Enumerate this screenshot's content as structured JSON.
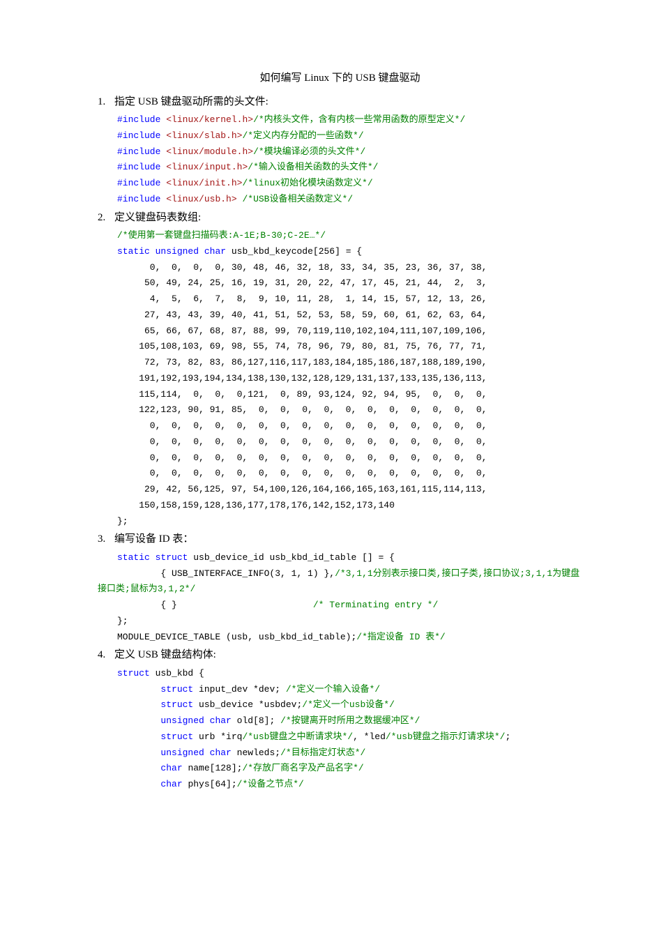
{
  "title": "如何编写 Linux 下的 USB 键盘驱动",
  "sections": {
    "s1": {
      "num": "1.",
      "heading": "指定 USB 键盘驱动所需的头文件:",
      "code_html": "<span class='kw'>#include</span> <span class='str'>&lt;linux/kernel.h&gt;</span><span class='cmt'>/*内核头文件，含有内核一些常用函数的原型定义*/</span>\n<span class='kw'>#include</span> <span class='str'>&lt;linux/slab.h&gt;</span><span class='cmt'>/*定义内存分配的一些函数*/</span>\n<span class='kw'>#include</span> <span class='str'>&lt;linux/module.h&gt;</span><span class='cmt'>/*模块编译必须的头文件*/</span>\n<span class='kw'>#include</span> <span class='str'>&lt;linux/input.h&gt;</span><span class='cmt'>/*输入设备相关函数的头文件*/</span>\n<span class='kw'>#include</span> <span class='str'>&lt;linux/init.h&gt;</span><span class='cmt'>/*linux初始化模块函数定义*/</span>\n<span class='kw'>#include</span> <span class='str'>&lt;linux/usb.h&gt;</span> <span class='cmt'>/*USB设备相关函数定义*/</span>"
    },
    "s2": {
      "num": "2.",
      "heading": "定义键盘码表数组:",
      "code_html": "<span class='cmt'>/*使用第一套键盘扫描码表:A-1E;B-30;C-2E…*/</span>\n<span class='kw'>static</span> <span class='kw'>unsigned</span> <span class='kw'>char</span> usb_kbd_keycode[256] = {\n      0,  0,  0,  0, 30, 48, 46, 32, 18, 33, 34, 35, 23, 36, 37, 38,\n     50, 49, 24, 25, 16, 19, 31, 20, 22, 47, 17, 45, 21, 44,  2,  3,\n      4,  5,  6,  7,  8,  9, 10, 11, 28,  1, 14, 15, 57, 12, 13, 26,\n     27, 43, 43, 39, 40, 41, 51, 52, 53, 58, 59, 60, 61, 62, 63, 64,\n     65, 66, 67, 68, 87, 88, 99, 70,119,110,102,104,111,107,109,106,\n    105,108,103, 69, 98, 55, 74, 78, 96, 79, 80, 81, 75, 76, 77, 71,\n     72, 73, 82, 83, 86,127,116,117,183,184,185,186,187,188,189,190,\n    191,192,193,194,134,138,130,132,128,129,131,137,133,135,136,113,\n    115,114,  0,  0,  0,121,  0, 89, 93,124, 92, 94, 95,  0,  0,  0,\n    122,123, 90, 91, 85,  0,  0,  0,  0,  0,  0,  0,  0,  0,  0,  0,\n      0,  0,  0,  0,  0,  0,  0,  0,  0,  0,  0,  0,  0,  0,  0,  0,\n      0,  0,  0,  0,  0,  0,  0,  0,  0,  0,  0,  0,  0,  0,  0,  0,\n      0,  0,  0,  0,  0,  0,  0,  0,  0,  0,  0,  0,  0,  0,  0,  0,\n      0,  0,  0,  0,  0,  0,  0,  0,  0,  0,  0,  0,  0,  0,  0,  0,\n     29, 42, 56,125, 97, 54,100,126,164,166,165,163,161,115,114,113,\n    150,158,159,128,136,177,178,176,142,152,173,140\n};"
    },
    "s3": {
      "num": "3.",
      "heading": "编写设备 ID 表：",
      "code_html": "<span class='kw'>static</span> <span class='kw'>struct</span> usb_device_id usb_kbd_id_table [] = {\n        { USB_INTERFACE_INFO(3, 1, 1) },<span class='cmt'>/*3,1,1分别表示接口类,接口子类,接口协议;3,1,1为键盘</span>",
      "wrap_html": "<span class='cmt'>接口类;鼠标为3,1,2*/</span>",
      "code_html2": "        { }                         <span class='cmt'>/* Terminating entry */</span>\n};\nMODULE_DEVICE_TABLE (usb, usb_kbd_id_table);<span class='cmt'>/*指定设备 ID 表*/</span>"
    },
    "s4": {
      "num": "4.",
      "heading": "定义 USB 键盘结构体:",
      "code_html": "<span class='kw'>struct</span> usb_kbd {\n        <span class='kw'>struct</span> input_dev *dev; <span class='cmt'>/*定义一个输入设备*/</span>\n        <span class='kw'>struct</span> usb_device *usbdev;<span class='cmt'>/*定义一个usb设备*/</span>\n        <span class='kw'>unsigned</span> <span class='kw'>char</span> old[8]; <span class='cmt'>/*按键离开时所用之数据缓冲区*/</span>\n        <span class='kw'>struct</span> urb *irq<span class='cmt'>/*usb键盘之中断请求块*/</span>, *led<span class='cmt'>/*usb键盘之指示灯请求块*/</span>;\n        <span class='kw'>unsigned</span> <span class='kw'>char</span> newleds;<span class='cmt'>/*目标指定灯状态*/</span>\n        <span class='kw'>char</span> name[128];<span class='cmt'>/*存放厂商名字及产品名字*/</span>\n        <span class='kw'>char</span> phys[64];<span class='cmt'>/*设备之节点*/</span>"
    }
  }
}
